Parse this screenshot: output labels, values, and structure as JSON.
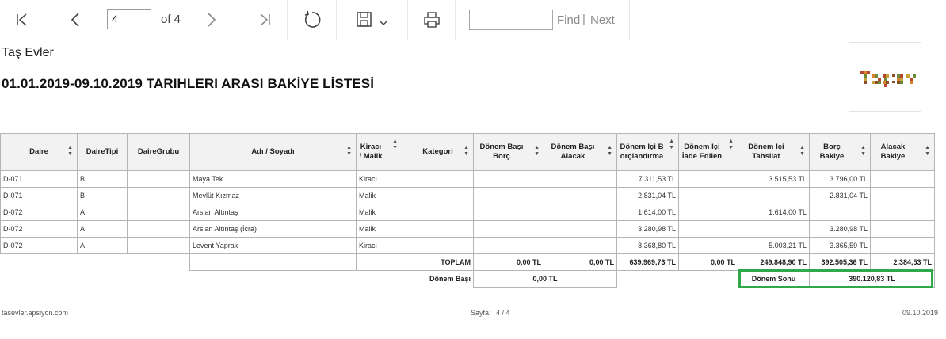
{
  "toolbar": {
    "page_value": "4",
    "of_label": "of 4",
    "find_label": "Find",
    "separator": "|",
    "next_label": "Next"
  },
  "report": {
    "company": "Taş Evler",
    "title": "01.01.2019-09.10.2019 TARIHLERI ARASI BAKİYE LİSTESİ",
    "logo_text": "TAŞEV"
  },
  "table": {
    "headers": [
      "Daire",
      "DaireTipi",
      "DaireGrubu",
      "Adı / Soyadı",
      "Kiracı / Malik",
      "Kategori",
      "Dönem Başı Borç",
      "Dönem Başı Alacak",
      "Dönem İçi Borçlandırma",
      "Dönem İçi İade Edilen",
      "Dönem İçi Tahsilat",
      "Borç Bakiye",
      "Alacak Bakiye"
    ],
    "rows": [
      [
        "D-071",
        "B",
        "",
        "Maya Tek",
        "Kiracı",
        "",
        "",
        "",
        "7.311,53 TL",
        "",
        "3.515,53 TL",
        "3.796,00 TL",
        ""
      ],
      [
        "D-071",
        "B",
        "",
        "Mevlüt Kızmaz",
        "Malik",
        "",
        "",
        "",
        "2.831,04 TL",
        "",
        "",
        "2.831,04 TL",
        ""
      ],
      [
        "D-072",
        "A",
        "",
        "Arslan Altıntaş",
        "Malik",
        "",
        "",
        "",
        "1.614,00 TL",
        "",
        "1.614,00 TL",
        "",
        ""
      ],
      [
        "D-072",
        "A",
        "",
        "Arslan Altıntaş (İcra)",
        "Malik",
        "",
        "",
        "",
        "3.280,98 TL",
        "",
        "",
        "3.280,98 TL",
        ""
      ],
      [
        "D-072",
        "A",
        "",
        "Levent Yaprak",
        "Kiracı",
        "",
        "",
        "",
        "8.368,80 TL",
        "",
        "5.003,21 TL",
        "3.365,59 TL",
        ""
      ]
    ],
    "totals": {
      "label": "TOPLAM",
      "values": [
        "0,00 TL",
        "0,00 TL",
        "639.969,73 TL",
        "0,00 TL",
        "249.848,90 TL",
        "392.505,36 TL",
        "2.384,53 TL"
      ]
    },
    "period_start": {
      "label": "Dönem Başı",
      "value": "0,00 TL"
    },
    "period_end": {
      "label": "Dönem Sonu",
      "value": "390.120,83 TL"
    }
  },
  "footer": {
    "site": "tasevler.apsiyon.com",
    "page_label": "Sayfa:",
    "page_value": "4 / 4",
    "date": "09.10.2019"
  },
  "colors": {
    "highlight": "#2ea84a"
  }
}
